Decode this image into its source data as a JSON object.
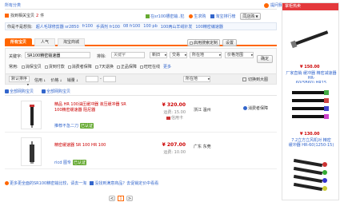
{
  "topbar": {
    "all_categories": "所有分类",
    "ask_label": "提问我问",
    "found_prefix": "找到相关宝贝",
    "found_count": "2",
    "found_suffix": "件",
    "hot_search": "在sr100槽密输..犯",
    "sell_same": "生求购",
    "mall_ranking": "淘宝排行榜",
    "similar_label": "同店购"
  },
  "related": {
    "label": "你是不是想找:",
    "links": [
      "超人毛球修剪器 sr2850",
      "fr100",
      "手洒剂 fr100",
      "08 fr100",
      "100 pb",
      "100两山羊绒针发",
      "100精密编速器"
    ]
  },
  "tabs": {
    "all": "所有宝贝",
    "popular": "人气",
    "mall": "淘宝商城",
    "set_search": "启用搜索定制",
    "settings": "设置"
  },
  "filters": {
    "keyword_label": "关键字:",
    "keyword_value": "SR100精密输速器",
    "exclude_label": "排除:",
    "exclude_placeholder": "关键字",
    "category_value": "新旧",
    "trade_value": "交易",
    "location_value": "所在地",
    "range_value": "价格范围",
    "confirm": "确定",
    "common_label": "常用:",
    "checkboxes": [
      "消保宝贝",
      "货到付款",
      "消费者保障",
      "7天退换",
      "正品保障",
      "旺旺在线"
    ],
    "more": "更多",
    "sort_default": "默认排序",
    "sort_credit": "信用",
    "sort_price": "价格",
    "sort_sales": "销量",
    "price_from": "",
    "price_to": "",
    "location2": "所在地",
    "view_list": "切换到大图"
  },
  "sub_tabs": {
    "all_items": "全部网购宝贝",
    "compare": "全部网购宝贝",
    "seller_label": "卖家"
  },
  "listings": [
    {
      "title_line1": "精品 HR 100油压缓冲器 液压缓冲器 SR",
      "title_line2": "100精密缓速器 阻尼器",
      "shop": "推荐不急二刀",
      "shop_badge": "已认证",
      "price": "¥ 320.00",
      "shipping": "运费: 15.00",
      "sales": "信用卡",
      "location": "浙江 温州",
      "guarantee": "消费者保障"
    },
    {
      "title_line1": "精密缓速器 SR 100 HR 100",
      "title_line2": "",
      "shop": "ricd 图专",
      "shop_badge": "已认证",
      "price": "¥ 207.00",
      "shipping": "运费: 10.00",
      "sales": "",
      "location": "广东 东莞",
      "guarantee": ""
    }
  ],
  "bottom": {
    "more_text": "更多更全面的SR100精密输比较，请去一淘",
    "not_found": "没找到满意商品？去促销定价中看看"
  },
  "pagination": {
    "prev": "<",
    "current": "1",
    "next": ">"
  },
  "sidebar": {
    "title": "掌柜热卖",
    "items": [
      {
        "price": "¥ 150.00",
        "desc_line1": "厂家直销 缓冲器 精密减速器 HR-",
        "desc_line2": "60(5B60) HR15"
      },
      {
        "price": "¥ 130.00",
        "desc_line1": "7.2立方立风机对 精密",
        "desc_line2": "缓冲器 HR-60(1250-15)"
      },
      {
        "price": "",
        "desc_line1": "",
        "desc_line2": ""
      }
    ]
  },
  "colors": {
    "orange_tab": "#f60",
    "price_red": "#c00",
    "link_blue": "#36c",
    "sidebar_header": "#e4393c"
  }
}
